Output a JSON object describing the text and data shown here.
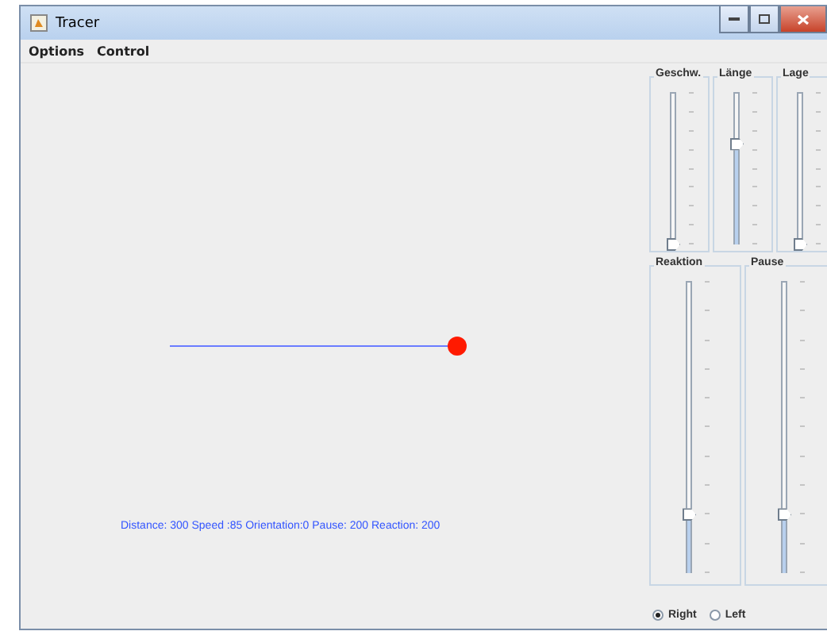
{
  "window": {
    "title": "Tracer"
  },
  "menu": [
    "Options",
    "Control"
  ],
  "status": "Distance: 300 Speed :85 Orientation:0 Pause: 200 Reaction: 200",
  "top_sliders": [
    {
      "label": "Geschw.",
      "level": 0
    },
    {
      "label": "Länge",
      "level": 0.66
    },
    {
      "label": "Lage",
      "level": 0
    }
  ],
  "bottom_sliders": [
    {
      "label": "Reaktion",
      "level": 0.2
    },
    {
      "label": "Pause",
      "level": 0.2
    }
  ],
  "direction": [
    {
      "label": "Right",
      "selected": true
    },
    {
      "label": "Left",
      "selected": false
    }
  ]
}
